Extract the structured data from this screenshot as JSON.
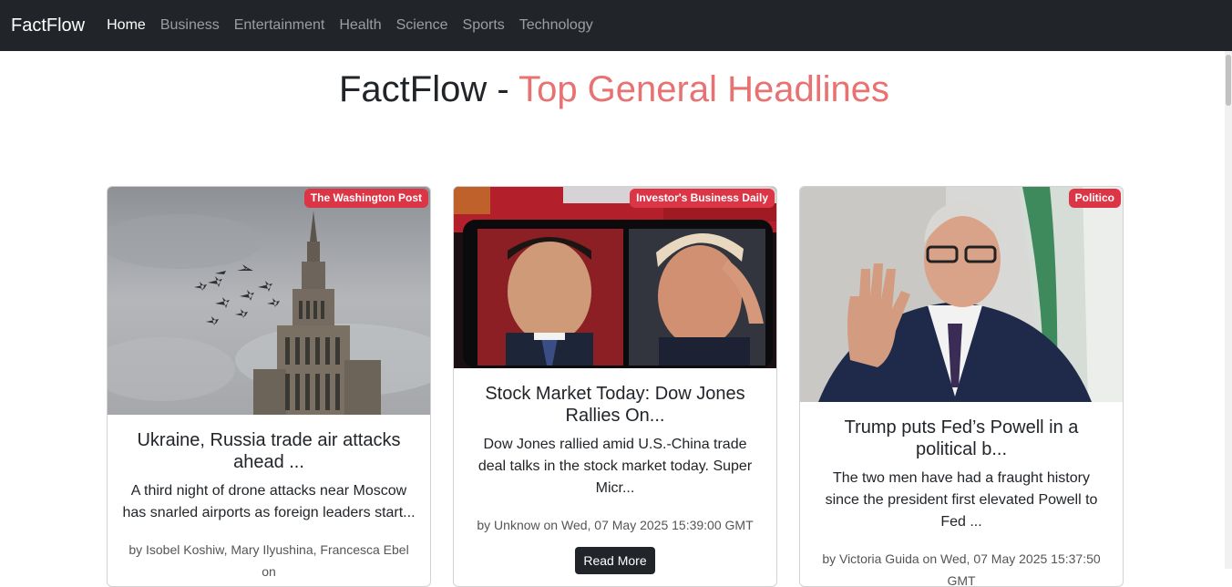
{
  "navbar": {
    "brand": "FactFlow",
    "links": [
      "Home",
      "Business",
      "Entertainment",
      "Health",
      "Science",
      "Sports",
      "Technology"
    ],
    "active": "Home"
  },
  "heading": {
    "prefix": "FactFlow - ",
    "accent": "Top General Headlines",
    "accent_color": "#e87171"
  },
  "colors": {
    "navbar_bg": "#212529",
    "badge_bg": "#dc3545",
    "button_bg": "#212529"
  },
  "cards": [
    {
      "source": "The Washington Post",
      "title": "Ukraine, Russia trade air attacks ahead ...",
      "description": "A third night of drone attacks near Moscow has snarled airports as foreign leaders start...",
      "meta": "by Isobel Koshiw, Mary Ilyushina, Francesca Ebel on"
    },
    {
      "source": "Investor's Business Daily",
      "title": "Stock Market Today: Dow Jones Rallies On...",
      "description": "Dow Jones rallied amid U.S.-China trade deal talks in the stock market today. Super Micr...",
      "meta": "by Unknow on Wed, 07 May 2025 15:39:00 GMT",
      "button": "Read More"
    },
    {
      "source": "Politico",
      "title": "Trump puts Fed’s Powell in a political b...",
      "description": "The two men have had a fraught history since the president first elevated Powell to Fed ...",
      "meta": "by Victoria Guida on Wed, 07 May 2025 15:37:50 GMT"
    }
  ]
}
